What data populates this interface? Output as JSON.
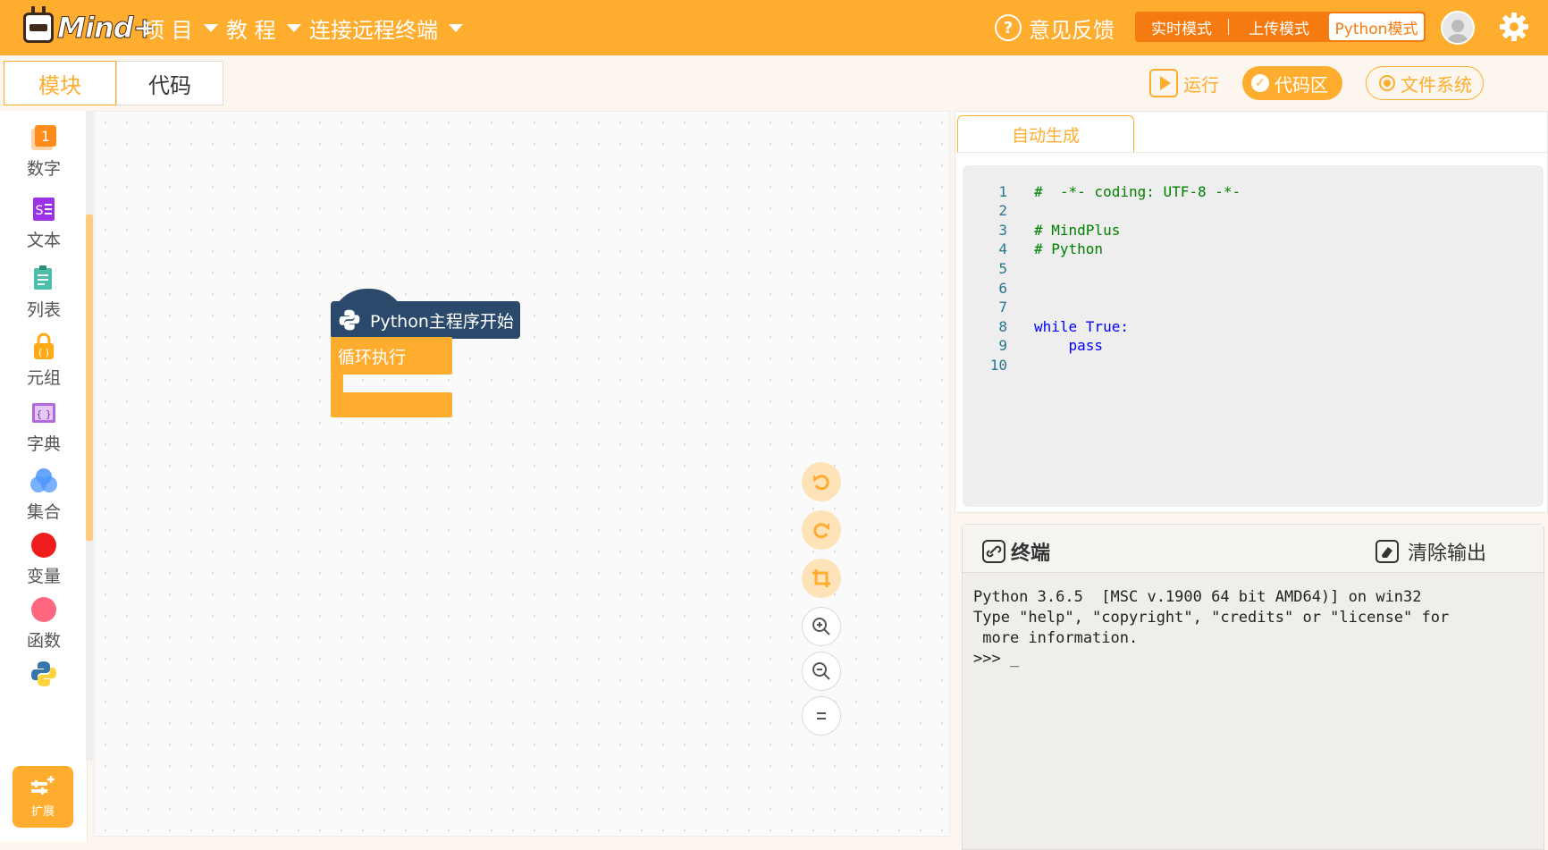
{
  "app": {
    "logo_text": "Mind+"
  },
  "topbar": {
    "menus": [
      "项 目",
      "教 程",
      "连接远程终端"
    ],
    "feedback": "意见反馈",
    "modes": [
      "实时模式",
      "上传模式",
      "Python模式"
    ],
    "active_mode": "Python模式"
  },
  "tabs": {
    "blocks": "模块",
    "code": "代码",
    "active": "模块"
  },
  "actions": {
    "run": "运行",
    "code_area": "代码区",
    "file_system": "文件系统"
  },
  "categories": [
    {
      "label": "数字",
      "icon": "number-icon",
      "color": "#ff8c1a"
    },
    {
      "label": "文本",
      "icon": "text-icon",
      "color": "#9c32e6"
    },
    {
      "label": "列表",
      "icon": "list-icon",
      "color": "#4cbfa8"
    },
    {
      "label": "元组",
      "icon": "tuple-icon",
      "color": "#ffab19"
    },
    {
      "label": "字典",
      "icon": "dictionary-icon",
      "color": "#b069d9"
    },
    {
      "label": "集合",
      "icon": "set-icon",
      "color": "#4c97ff"
    },
    {
      "label": "变量",
      "icon": "variable-icon",
      "color": "#ee1c1c"
    },
    {
      "label": "函数",
      "icon": "function-icon",
      "color": "#ff6680"
    },
    {
      "label": "",
      "icon": "python-icon",
      "color": "#3776ab"
    }
  ],
  "extend_label": "扩展",
  "blocks": {
    "hat": "Python主程序开始",
    "loop": "循环执行"
  },
  "code_panel": {
    "tab": "自动生成",
    "lines": [
      {
        "n": "1",
        "text": "#  -*- coding: UTF-8 -*-",
        "type": "comment"
      },
      {
        "n": "2",
        "text": "",
        "type": "plain"
      },
      {
        "n": "3",
        "text": "# MindPlus",
        "type": "comment"
      },
      {
        "n": "4",
        "text": "# Python",
        "type": "comment"
      },
      {
        "n": "5",
        "text": "",
        "type": "plain"
      },
      {
        "n": "6",
        "text": "",
        "type": "plain"
      },
      {
        "n": "7",
        "text": "",
        "type": "plain"
      },
      {
        "n": "8",
        "text": "while True:",
        "type": "keyword"
      },
      {
        "n": "9",
        "text": "    pass",
        "type": "keyword"
      },
      {
        "n": "10",
        "text": "",
        "type": "plain"
      }
    ]
  },
  "terminal": {
    "title": "终端",
    "clear": "清除输出",
    "output": "Python 3.6.5  [MSC v.1900 64 bit AMD64)] on win32\nType \"help\", \"copyright\", \"credits\" or \"license\" for\n more information.\n>>> _"
  },
  "colors": {
    "accent": "#ffad2f",
    "accent_dark": "#f57b10",
    "hat_block": "#2b4a6b"
  }
}
